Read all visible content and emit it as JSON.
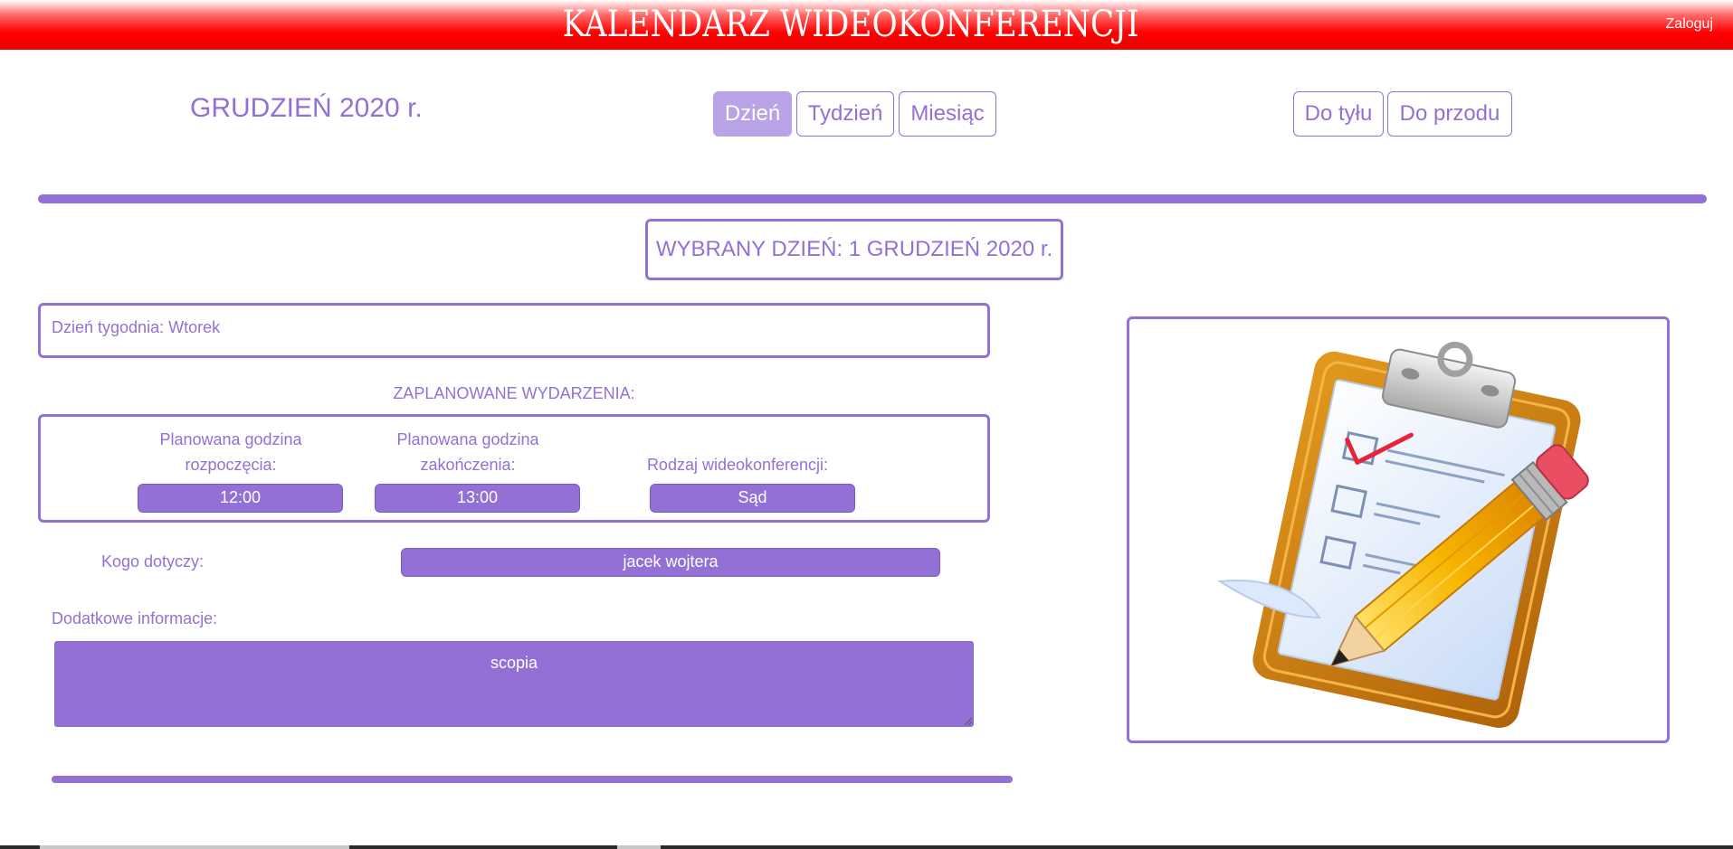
{
  "header": {
    "title": "KALENDARZ WIDEOKONFERENCJI",
    "login_label": "Zaloguj"
  },
  "calendar": {
    "month_title": "GRUDZIEŃ 2020 r.",
    "views": [
      "Dzień",
      "Tydzień",
      "Miesiąc"
    ],
    "active_view": "Dzień",
    "nav": {
      "back_label": "Do tyłu",
      "forward_label": "Do przodu"
    }
  },
  "selected_day": {
    "title": "WYBRANY DZIEŃ: 1 GRUDZIEŃ 2020 r.",
    "weekday_text": "Dzień tygodnia: Wtorek"
  },
  "events": {
    "heading": "ZAPLANOWANE WYDARZENIA:",
    "start_label_line1": "Planowana godzina",
    "start_label_line2": "rozpoczęcia:",
    "end_label_line1": "Planowana godzina",
    "end_label_line2": "zakończenia:",
    "type_label": "Rodzaj wideokonferencji:",
    "start_time": "12:00",
    "end_time": "13:00",
    "type": "Sąd"
  },
  "concerns": {
    "label": "Kogo dotyczy:",
    "value": "jacek wojtera"
  },
  "additional": {
    "label": "Dodatkowe informacje:",
    "value": "scopia"
  },
  "illustration": {
    "icon": "clipboard-pencil-icon"
  },
  "colors": {
    "accent": "#9370d6",
    "header_red": "#ff0000",
    "active_button": "#b9a3e6"
  }
}
